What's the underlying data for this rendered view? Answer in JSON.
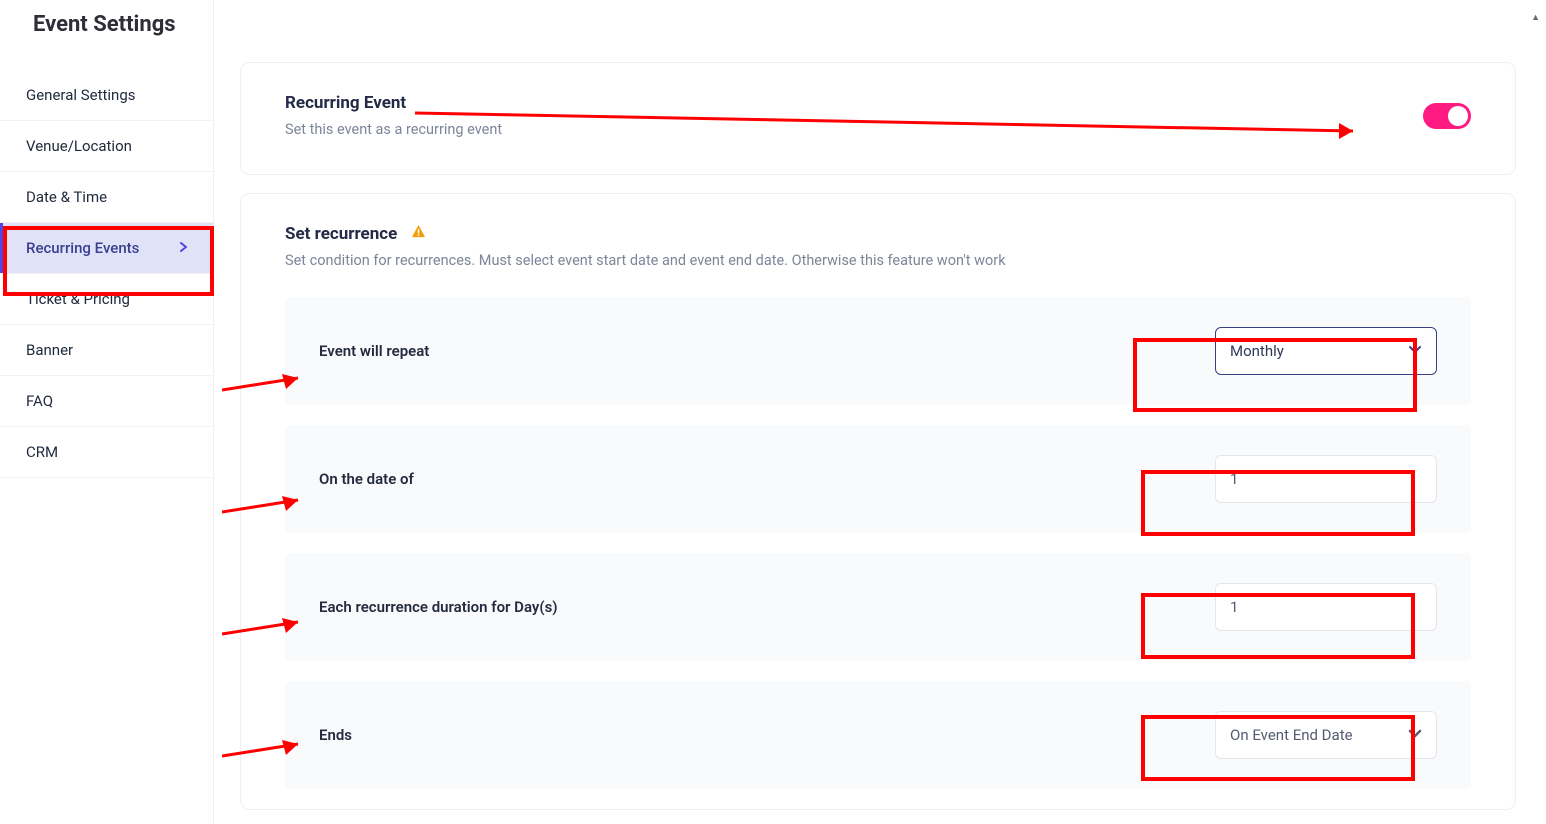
{
  "page_title": "Event Settings",
  "sidebar": {
    "items": [
      {
        "label": "General Settings"
      },
      {
        "label": "Venue/Location"
      },
      {
        "label": "Date & Time"
      },
      {
        "label": "Recurring Events",
        "active": true
      },
      {
        "label": "Ticket & Pricing"
      },
      {
        "label": "Banner"
      },
      {
        "label": "FAQ"
      },
      {
        "label": "CRM"
      }
    ]
  },
  "recurring_panel": {
    "title": "Recurring Event",
    "desc": "Set this event as a recurring event"
  },
  "recurrence_panel": {
    "title": "Set recurrence",
    "desc": "Set condition for recurrences. Must select event start date and event end date. Otherwise this feature won't work"
  },
  "fields": {
    "repeat": {
      "label": "Event will repeat",
      "value": "Monthly"
    },
    "on_date": {
      "label": "On the date of",
      "value": "1"
    },
    "duration": {
      "label": "Each recurrence duration for Day(s)",
      "value": "1"
    },
    "ends": {
      "label": "Ends",
      "value": "On Event End Date"
    }
  }
}
